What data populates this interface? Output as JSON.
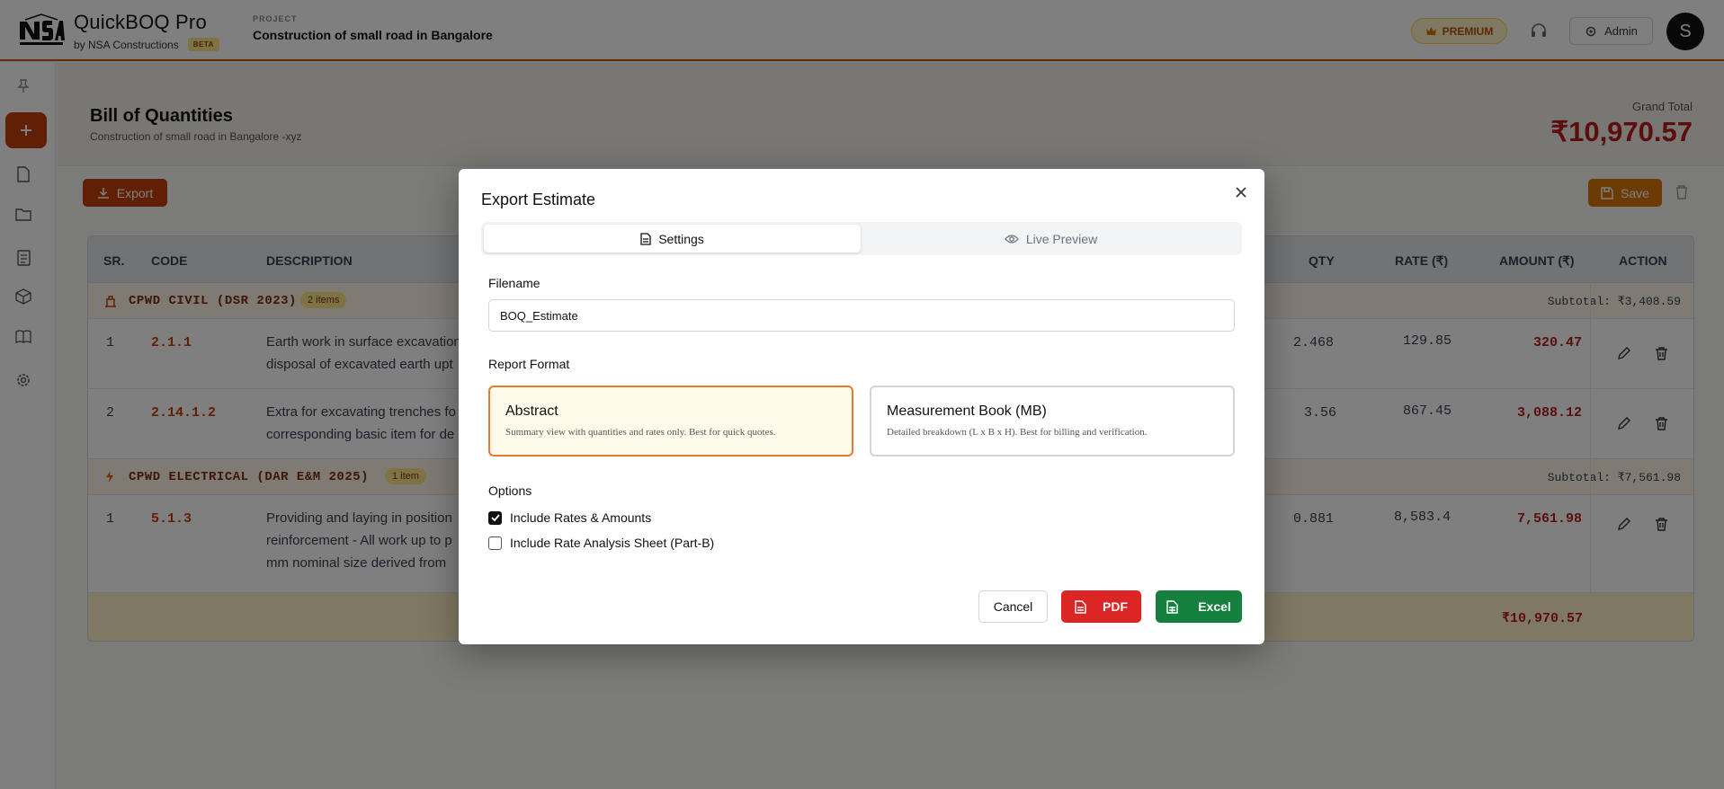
{
  "app": {
    "logo_text": "NSA",
    "title": "QuickBOQ Pro",
    "subtitle": "by NSA Constructions",
    "beta": "BETA",
    "project_label": "PROJECT",
    "project_name": "Construction of small road in Bangalore",
    "premium": "PREMIUM",
    "admin": "Admin",
    "avatar_initial": "S"
  },
  "page": {
    "title": "Bill of Quantities",
    "subtitle": "Construction of small road in Bangalore -xyz",
    "grand_total_label": "Grand Total",
    "grand_total": "₹10,970.57",
    "export_label": "Export",
    "save_label": "Save"
  },
  "table": {
    "headers": [
      "SR.",
      "CODE",
      "DESCRIPTION",
      "QTY",
      "RATE (₹)",
      "AMOUNT (₹)",
      "ACTION"
    ],
    "groups": [
      {
        "title": "CPWD CIVIL (DSR 2023)",
        "badge": "2 items",
        "subtotal": "Subtotal: ₹3,408.59",
        "rows": [
          {
            "sr": "1",
            "code": "2.1.1",
            "desc1": "Earth work in surface excavation",
            "desc2": "disposal of excavated earth upt",
            "qty": "2.468",
            "rate": "129.85",
            "amount": "320.47"
          },
          {
            "sr": "2",
            "code": "2.14.1.2",
            "desc1": "Extra for excavating trenches fo",
            "desc2": "corresponding basic item for de",
            "qty": "3.56",
            "rate": "867.45",
            "amount": "3,088.12"
          }
        ]
      },
      {
        "title": "CPWD ELECTRICAL (DAR E&M 2025)",
        "badge": "1 item",
        "subtotal": "Subtotal: ₹7,561.98",
        "rows": [
          {
            "sr": "1",
            "code": "5.1.3",
            "desc1": "Providing and laying in position",
            "desc2": "reinforcement - All work up to p",
            "desc3": "mm nominal size derived from",
            "qty": "0.881",
            "rate": "8,583.4",
            "amount": "7,561.98"
          }
        ]
      }
    ],
    "total": "₹10,970.57"
  },
  "modal": {
    "title": "Export Estimate",
    "tabs": {
      "settings": "Settings",
      "preview": "Live Preview"
    },
    "filename_label": "Filename",
    "filename_value": "BOQ_Estimate",
    "report_format_label": "Report Format",
    "formats": [
      {
        "title": "Abstract",
        "desc": "Summary view with quantities and rates only. Best for quick quotes.",
        "selected": true
      },
      {
        "title": "Measurement Book (MB)",
        "desc": "Detailed breakdown (L x B x H). Best for billing and verification.",
        "selected": false
      }
    ],
    "options_label": "Options",
    "options": [
      {
        "label": "Include Rates & Amounts",
        "checked": true
      },
      {
        "label": "Include Rate Analysis Sheet (Part-B)",
        "checked": false
      }
    ],
    "cancel": "Cancel",
    "pdf": "PDF",
    "excel": "Excel"
  },
  "colors": {
    "accent": "#c2410c",
    "pdf": "#dc2626",
    "excel": "#15803d",
    "selected_border": "#ea7a2b"
  }
}
